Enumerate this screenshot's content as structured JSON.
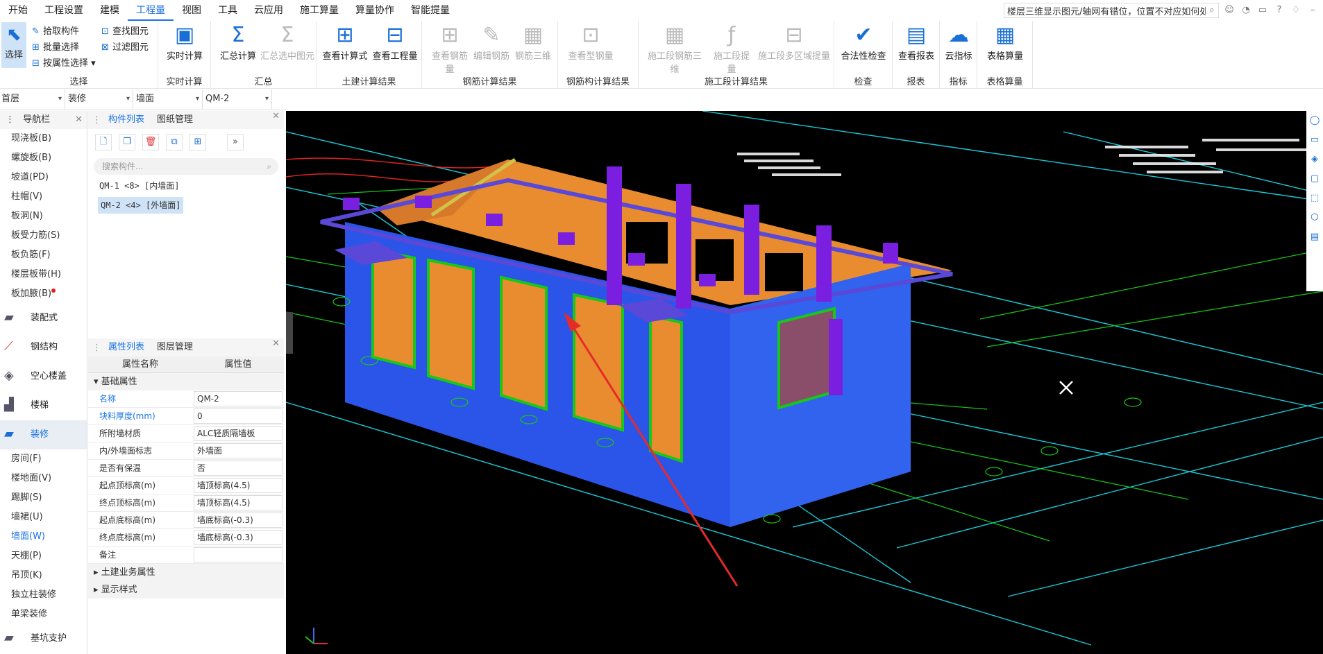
{
  "menu": {
    "items": [
      "开始",
      "工程设置",
      "建模",
      "工程量",
      "视图",
      "工具",
      "云应用",
      "施工算量",
      "算量协作",
      "智能提量"
    ],
    "active_index": 3,
    "help_search_text": "楼层三维显示图元/轴网有错位，位置不对应如何处理?"
  },
  "ribbon": {
    "select_group": {
      "select_label": "选择",
      "pick_label": "拾取构件",
      "batch_label": "批量选择",
      "attr_select_label": "按属性选择",
      "find_label": "查找图元",
      "filter_label": "过滤图元",
      "group_label": "选择"
    },
    "realtime_group": {
      "calc_label": "实时计算",
      "group_label": "实时计算"
    },
    "summary_group": {
      "calc_label": "汇总计算",
      "selected_label": "汇总选中图元",
      "group_label": "汇总"
    },
    "civil_group": {
      "formula_label": "查看计算式",
      "quantity_label": "查看工程量",
      "group_label": "土建计算结果"
    },
    "rebar_group": {
      "view_label": "查看钢筋量",
      "edit_label": "编辑钢筋",
      "threed_label": "钢筋三维",
      "group_label": "钢筋计算结果"
    },
    "steel_group": {
      "view_label": "查看型钢量",
      "group_label": "钢筋构计算结果"
    },
    "stage_group": {
      "rebar3d_label": "施工段钢筋三维",
      "extract_label": "施工段提量",
      "multi_label": "施工段多区域提量",
      "group_label": "施工段计算结果"
    },
    "check_group": {
      "legal_label": "合法性检查",
      "group_label": "检查"
    },
    "report_group": {
      "view_label": "查看报表",
      "group_label": "报表"
    },
    "index_group": {
      "cloud_label": "云指标",
      "group_label": "指标"
    },
    "table_group": {
      "table_label": "表格算量",
      "group_label": "表格算量"
    }
  },
  "floorbar": {
    "floor": "首层",
    "category": "装修",
    "type": "墙面",
    "component": "QM-2"
  },
  "nav": {
    "title": "导航栏",
    "items_top": [
      "现浇板(B)",
      "螺旋板(B)",
      "坡道(PD)",
      "柱帽(V)",
      "板洞(N)",
      "板受力筋(S)",
      "板负筋(F)",
      "楼层板带(H)",
      "板加腋(B)"
    ],
    "cats": [
      "装配式",
      "钢结构",
      "空心楼盖",
      "楼梯",
      "装修"
    ],
    "items_bottom": [
      "房间(F)",
      "楼地面(V)",
      "踢脚(S)",
      "墙裙(U)",
      "墙面(W)",
      "天棚(P)",
      "吊顶(K)",
      "独立柱装修",
      "单梁装修"
    ],
    "last_cat": "基坑支护"
  },
  "components": {
    "tab_list": "构件列表",
    "tab_drawings": "图纸管理",
    "search_placeholder": "搜索构件...",
    "items": [
      "QM-1 <8> [内墙面]",
      "QM-2 <4> [外墙面]"
    ]
  },
  "properties": {
    "tab_list": "属性列表",
    "tab_layers": "图层管理",
    "col_name": "属性名称",
    "col_value": "属性值",
    "section_basic": "基础属性",
    "rows": [
      {
        "name": "名称",
        "value": "QM-2"
      },
      {
        "name": "块料厚度(mm)",
        "value": "0"
      },
      {
        "name": "所附墙材质",
        "value": "ALC轻质隔墙板"
      },
      {
        "name": "内/外墙面标志",
        "value": "外墙面"
      },
      {
        "name": "是否有保温",
        "value": "否"
      },
      {
        "name": "起点顶标高(m)",
        "value": "墙顶标高(4.5)"
      },
      {
        "name": "终点顶标高(m)",
        "value": "墙顶标高(4.5)"
      },
      {
        "name": "起点底标高(m)",
        "value": "墙底标高(-0.3)"
      },
      {
        "name": "终点底标高(m)",
        "value": "墙底标高(-0.3)"
      },
      {
        "name": "备注",
        "value": ""
      }
    ],
    "section_civil": "土建业务属性",
    "section_display": "显示样式"
  },
  "colors": {
    "accent": "#1a73e8",
    "wall_blue": "#2a55e8",
    "wall_orange": "#e98c2f",
    "column_purple": "#7a1fe0",
    "cad_green": "#18c818",
    "cad_cyan": "#17c9d8",
    "arrow_red": "#e52a2a"
  }
}
